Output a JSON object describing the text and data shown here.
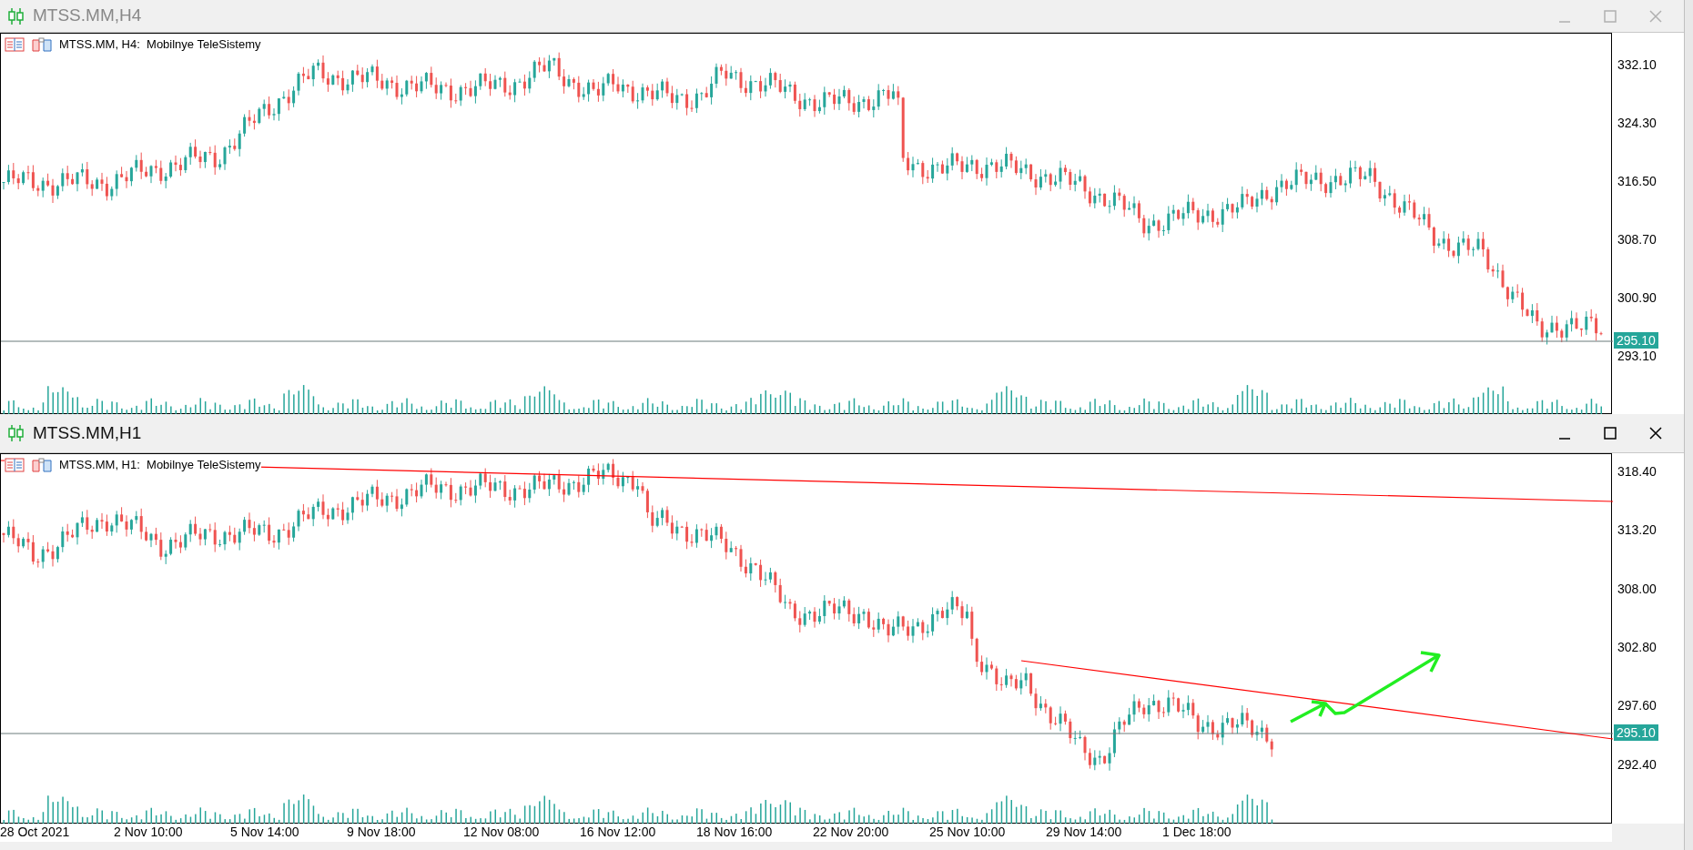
{
  "windows": [
    {
      "title": "MTSS.MM,H4",
      "active": false,
      "chart_label": "MTSS.MM, H4:  Mobilnye TeleSistemy",
      "price_axis": [
        "332.10",
        "324.30",
        "316.50",
        "308.70",
        "300.90",
        "293.10"
      ],
      "current_price": "295.10"
    },
    {
      "title": "MTSS.MM,H1",
      "active": true,
      "chart_label": "MTSS.MM, H1:  Mobilnye TeleSistemy",
      "price_axis": [
        "318.40",
        "313.20",
        "308.00",
        "302.80",
        "297.60",
        "292.40"
      ],
      "current_price": "295.10",
      "time_axis": [
        "28 Oct 2021",
        "2 Nov 10:00",
        "5 Nov 14:00",
        "9 Nov 18:00",
        "12 Nov 08:00",
        "16 Nov 12:00",
        "18 Nov 16:00",
        "22 Nov 20:00",
        "25 Nov 10:00",
        "29 Nov 14:00",
        "1 Dec 18:00"
      ]
    }
  ]
}
